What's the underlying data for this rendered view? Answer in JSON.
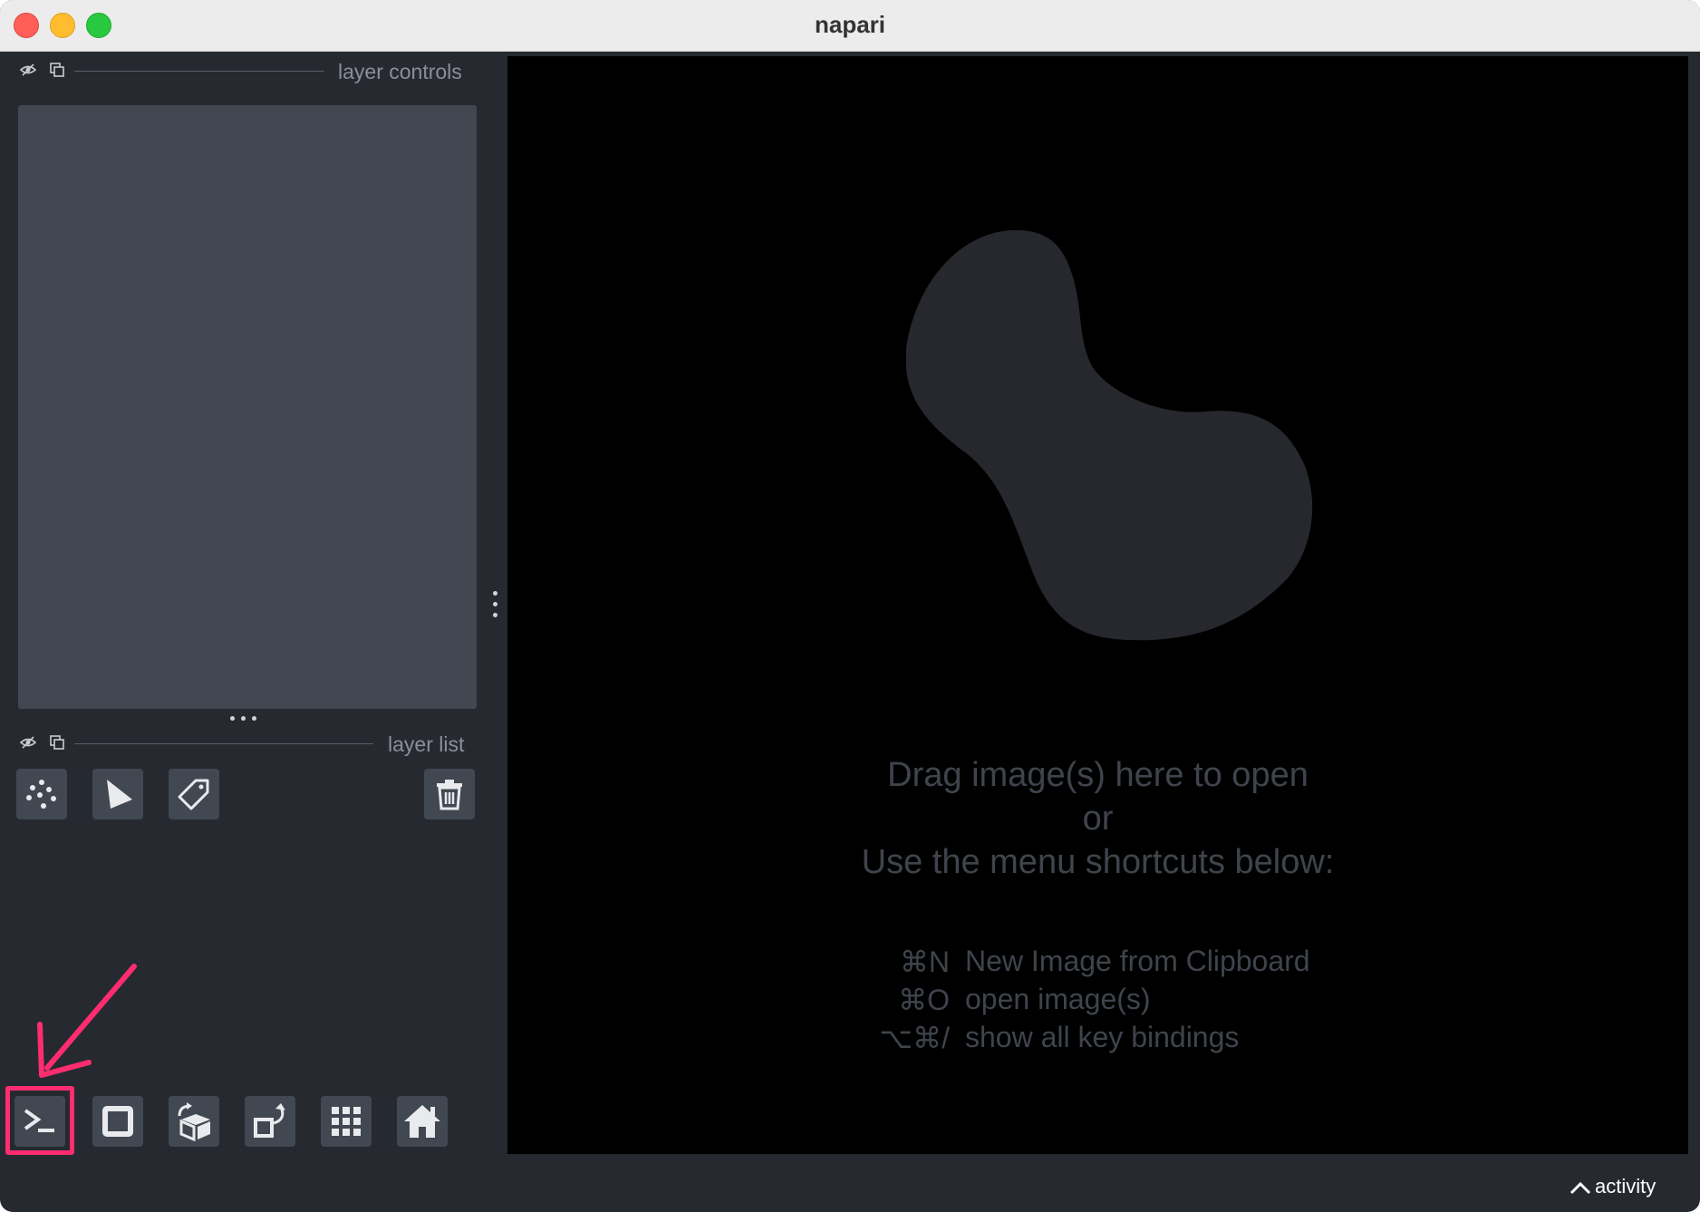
{
  "window": {
    "title": "napari"
  },
  "layer_controls": {
    "label": "layer controls"
  },
  "layer_list": {
    "label": "layer list"
  },
  "layer_buttons": [
    {
      "name": "new-points-layer-button",
      "icon": "points-icon"
    },
    {
      "name": "new-shapes-layer-button",
      "icon": "shapes-icon"
    },
    {
      "name": "new-labels-layer-button",
      "icon": "labels-icon"
    },
    {
      "name": "delete-layer-button",
      "icon": "trash-icon"
    }
  ],
  "viewer_buttons": [
    {
      "name": "console-button",
      "icon": "console-icon",
      "highlighted": true
    },
    {
      "name": "ndisplay-button",
      "icon": "square-icon"
    },
    {
      "name": "roll-dims-button",
      "icon": "cube-rotate-icon"
    },
    {
      "name": "transpose-dims-button",
      "icon": "transpose-icon"
    },
    {
      "name": "grid-view-button",
      "icon": "grid-icon"
    },
    {
      "name": "home-button",
      "icon": "home-icon"
    }
  ],
  "welcome": {
    "line1": "Drag image(s) here to open",
    "line2": "or",
    "line3": "Use the menu shortcuts below:",
    "shortcuts": [
      {
        "key": "⌘N",
        "text": "New Image from Clipboard"
      },
      {
        "key": "⌘O",
        "text": "open image(s)"
      },
      {
        "key": "⌥⌘/",
        "text": "show all key bindings"
      }
    ]
  },
  "status": {
    "activity_label": "activity"
  },
  "colors": {
    "background": "#262930",
    "panel": "#414851",
    "canvas": "#000000",
    "highlight": "#ff2d6f",
    "logo": "#26282e"
  }
}
